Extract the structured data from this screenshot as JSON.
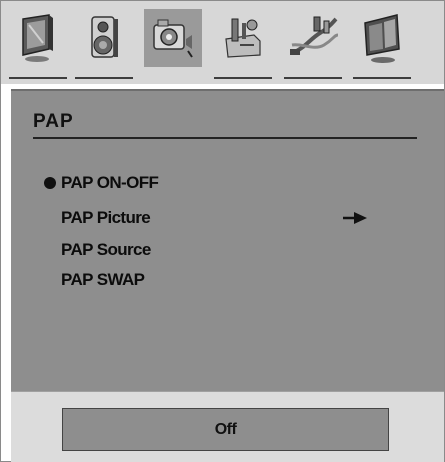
{
  "toolbar": {
    "icons": [
      {
        "name": "tv-picture-icon"
      },
      {
        "name": "speaker-icon"
      },
      {
        "name": "camera-timer-icon",
        "selected": true
      },
      {
        "name": "settings-tools-icon"
      },
      {
        "name": "cables-icon"
      },
      {
        "name": "pap-screen-icon"
      }
    ]
  },
  "menu": {
    "title": "PAP",
    "items": [
      {
        "label": "PAP ON-OFF",
        "selected": true
      },
      {
        "label": "PAP Picture",
        "has_submenu": true
      },
      {
        "label": "PAP Source"
      },
      {
        "label": "PAP SWAP"
      }
    ]
  },
  "value_bar": {
    "value": "Off"
  },
  "colors": {
    "panel_bg": "#8e8e8e",
    "strip_bg": "#d7d7d7",
    "selected_icon_bg": "#9a9a9a",
    "text": "#111111"
  }
}
